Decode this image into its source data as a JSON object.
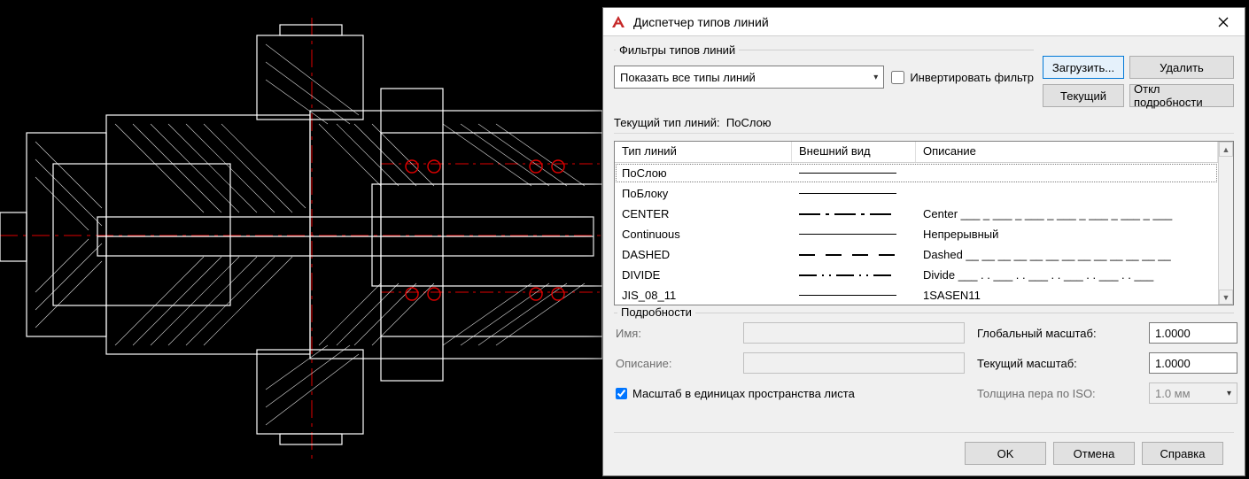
{
  "window": {
    "title": "Диспетчер типов линий"
  },
  "filter": {
    "group_label": "Фильтры типов линий",
    "dropdown_value": "Показать все типы линий",
    "invert_label": "Инвертировать фильтр",
    "invert_checked": false
  },
  "buttons": {
    "load": "Загрузить...",
    "delete": "Удалить",
    "current": "Текущий",
    "toggle_details": "Откл подробности",
    "ok": "OK",
    "cancel": "Отмена",
    "help": "Справка"
  },
  "current_linetype": {
    "label": "Текущий тип линий:",
    "value": "ПоСлою"
  },
  "table": {
    "headers": {
      "c1": "Тип линий",
      "c2": "Внешний вид",
      "c3": "Описание"
    },
    "rows": [
      {
        "name": "ПоСлою",
        "style": "solid",
        "desc": "",
        "selected": true
      },
      {
        "name": "ПоБлоку",
        "style": "solid",
        "desc": ""
      },
      {
        "name": "CENTER",
        "style": "center",
        "desc": "Center ___ _ ___ _ ___ _ ___ _ ___ _ ___ _ ___"
      },
      {
        "name": "Continuous",
        "style": "solid",
        "desc": "Непрерывный"
      },
      {
        "name": "DASHED",
        "style": "dashed",
        "desc": "Dashed __ __ __ __ __ __ __ __ __ __ __ __ __"
      },
      {
        "name": "DIVIDE",
        "style": "divide",
        "desc": "Divide ___ . . ___ . . ___ . . ___ . . ___ . . ___"
      },
      {
        "name": "JIS_08_11",
        "style": "solid",
        "desc": "1SASEN11"
      }
    ]
  },
  "details": {
    "group_label": "Подробности",
    "name_label": "Имя:",
    "name_value": "",
    "desc_label": "Описание:",
    "desc_value": "",
    "scale_units_label": "Масштаб в единицах пространства листа",
    "scale_units_checked": true,
    "global_scale_label": "Глобальный масштаб:",
    "global_scale_value": "1.0000",
    "current_scale_label": "Текущий масштаб:",
    "current_scale_value": "1.0000",
    "pen_width_label": "Толщина пера по ISO:",
    "pen_width_value": "1.0 мм"
  }
}
